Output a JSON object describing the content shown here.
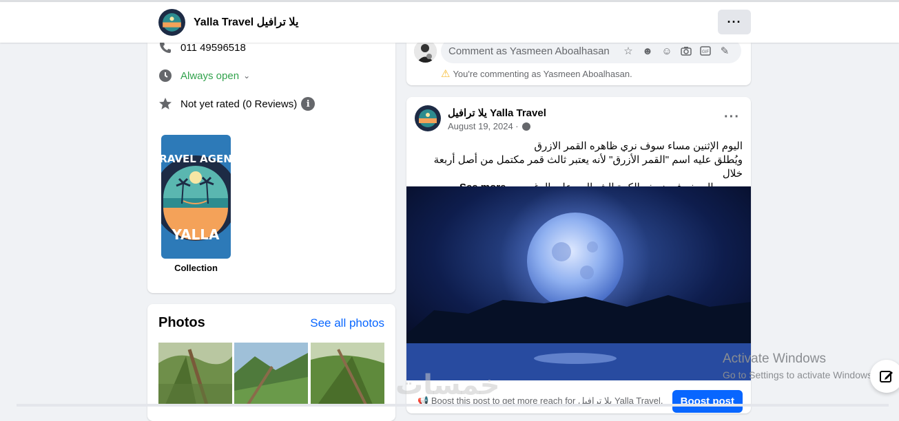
{
  "header": {
    "page_name": "Yalla Travel يلا ترافيل",
    "more_label": "···"
  },
  "intro": {
    "phone": "011 49596518",
    "hours": "Always open",
    "rating": "Not yet rated (0 Reviews)",
    "info_glyph": "i",
    "collection_label": "Collection"
  },
  "logo": {
    "top_text": "TRAVEL AGENT",
    "bottom_text": "YALLA"
  },
  "photos": {
    "title": "Photos",
    "see_all": "See all photos"
  },
  "comment": {
    "placeholder": "Comment as Yasmeen Aboalhasan",
    "warning": "You're commenting as Yasmeen Aboalhasan."
  },
  "post": {
    "author": "يلا ترافيل Yalla Travel",
    "date": "August 19, 2024 ·",
    "more_label": "···",
    "line1": "اليوم الإثنين  مساء سوف نري ظاهره  القمر الازرق",
    "line2": "ويُطلق عليه اسم \"القمر الأزرق\" لأنه يعتبر ثالث قمر مكتمل من أصل أربعة خلال",
    "line3": "موسم الصيف في نصف الكرة الشمالي، على الرغم م...",
    "see_more": "See more",
    "boost_text": "Boost this post to get more reach for يلا ترافيل Yalla Travel.",
    "boost_button": "Boost post"
  },
  "os_overlay": {
    "activate_title": "Activate Windows",
    "activate_sub": "Go to Settings to activate Windows.",
    "watermark": "خمسات"
  },
  "colors": {
    "accent": "#0866ff",
    "open_green": "#31a24c",
    "background": "#f0f2f5",
    "logo_navy": "#1d2b45",
    "logo_teal": "#2d8c8f",
    "logo_sand": "#f4a259"
  },
  "icons": [
    "phone-icon",
    "clock-icon",
    "star-icon",
    "info-icon",
    "sticker-icon",
    "avatar-sticker-icon",
    "emoji-icon",
    "camera-icon",
    "gif-icon",
    "sticker-alt-icon",
    "warning-icon",
    "globe-icon",
    "megaphone-icon",
    "edit-icon"
  ]
}
